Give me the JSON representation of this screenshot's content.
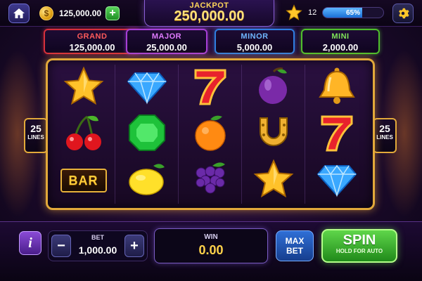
{
  "top": {
    "balance": "125,000.00",
    "add_label": "+",
    "coin_symbol": "$",
    "jackpot_label": "JACKPOT",
    "jackpot_value": "250,000.00",
    "level": "12",
    "xp_percent": "65%",
    "xp_fraction": 0.65
  },
  "tiers": [
    {
      "name": "GRAND",
      "value": "125,000.00",
      "color": "#d6303c"
    },
    {
      "name": "MAJOR",
      "value": "25,000.00",
      "color": "#a63fd6"
    },
    {
      "name": "MINOR",
      "value": "5,000.00",
      "color": "#2f7ee0"
    },
    {
      "name": "MINI",
      "value": "2,000.00",
      "color": "#4fbf2c"
    }
  ],
  "reels": {
    "lines_value": "25",
    "lines_label": "LINES",
    "bar_text": "BAR",
    "grid": [
      [
        "star",
        "diamond",
        "seven",
        "plum",
        "bell"
      ],
      [
        "cherry",
        "emerald",
        "orange",
        "horseshoe",
        "seven"
      ],
      [
        "bar",
        "lemon",
        "grapes",
        "star",
        "diamond"
      ]
    ]
  },
  "bottom": {
    "info_label": "i",
    "bet_label": "BET",
    "bet_value": "1,000.00",
    "minus_label": "−",
    "plus_label": "+",
    "win_label": "WIN",
    "win_value": "0.00",
    "maxbet_line1": "MAX",
    "maxbet_line2": "BET",
    "spin_label": "SPIN",
    "spin_sub": "HOLD FOR AUTO"
  }
}
